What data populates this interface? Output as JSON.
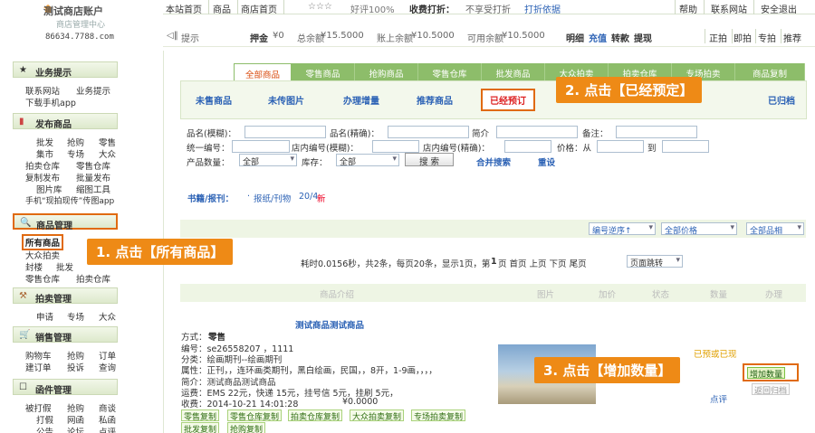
{
  "logo": {
    "title": "测试商店账户",
    "subtitle": "商店管理中心",
    "phone": "86634.7788.com"
  },
  "topnav": {
    "items": [
      "本站首页",
      "商品",
      "商店首页"
    ],
    "stars": "☆☆☆",
    "rating": "好评100%",
    "discount_label": "收费打折：",
    "discount_value": "不享受打折",
    "discount_link": "打折依据",
    "right": [
      "帮助",
      "联系网站",
      "安全退出"
    ]
  },
  "bar2": {
    "hint": "提示",
    "deposit_label": "押金",
    "deposit_value": "¥0",
    "total_label": "总余额",
    "total_value": "¥15.5000",
    "account_label": "账上余额",
    "account_value": "¥10.5000",
    "avail_label": "可用余额",
    "avail_value": "¥10.5000",
    "links": [
      "明细",
      "充值",
      "转款",
      "提现"
    ],
    "right": [
      "正拍",
      "即拍",
      "专拍",
      "推荐"
    ]
  },
  "sidebar": {
    "sections": [
      "业务提示",
      "发布商品",
      "商品管理",
      "拍卖管理",
      "销售管理",
      "函件管理"
    ],
    "s1": [
      "联系网站",
      "业务提示",
      "下载手机app"
    ],
    "s2": [
      "批发",
      "抢购",
      "零售",
      "集市",
      "专场",
      "大众",
      "拍卖仓库",
      "零售仓库",
      "复制发布",
      "批量发布",
      "图片库",
      "缩图工具",
      "手机“现拍现传”传图app"
    ],
    "s3_all": "所有商品",
    "s3": [
      "大众拍卖",
      "封楼",
      "批发",
      "零售仓库",
      "拍卖仓库"
    ],
    "s4": [
      "申请",
      "专场",
      "大众"
    ],
    "s5": [
      "购物车",
      "抢购",
      "订单",
      "建订单",
      "投诉",
      "查询"
    ],
    "s6": [
      "被打假",
      "抢购",
      "商谈",
      "打假",
      "网函",
      "私函",
      "公告",
      "论坛",
      "点评"
    ]
  },
  "tabs": [
    "全部商品",
    "零售商品",
    "抢购商品",
    "零售仓库",
    "批发商品",
    "大众拍卖",
    "拍卖仓库",
    "专场拍卖",
    "商品复制"
  ],
  "subtabs": [
    "未售商品",
    "未传图片",
    "办理增量",
    "推荐商品",
    "已经预订",
    "已归档"
  ],
  "form": {
    "name_fuzzy": "品名(模糊)：",
    "name_exact": "品名(精确)：",
    "intro": "简介",
    "note": "备注：",
    "code": "统一编号：",
    "store_fuzzy": "店内编号(模糊)：",
    "store_exact": "店内编号(精确)：",
    "price": "价格：从",
    "to": "到",
    "qty": "产品数量：",
    "qty_val": "全部",
    "stock": "库存：",
    "stock_val": "全部",
    "search": "搜 索",
    "combined": "合并搜索",
    "reset": "重设"
  },
  "category": {
    "label": "书籍/报刊：",
    "path": "报纸/刊物",
    "count": "20/4",
    "new": "新"
  },
  "filters": [
    "编号逆序↑",
    "全部价格",
    "全部品相"
  ],
  "stats": {
    "text": "耗时0.0156秒，共2条，每页20条，显示1页，第",
    "page": "1",
    "text2": "页 首页 上页 下页 尾页",
    "jump": "页面跳转"
  },
  "table_head": [
    "商品介绍",
    "图片",
    "加价",
    "状态",
    "数量",
    "办理"
  ],
  "product": {
    "title": "测试商品测试商品",
    "method_label": "方式：",
    "method": "零售",
    "code": "编号：se26558207 ，1111",
    "category": "分类：绘画期刊--绘画期刊",
    "attr": "属性：正刊，，连环画类期刊，黑白绘画，民国，，8开，1-9画，，，，",
    "intro": "简介：测试商品测试商品",
    "ship": "运费：EMS 22元，快递 15元，挂号信 5元，挂刷 5元，",
    "time": "收费：2014-10-21 14:01:28",
    "fee": "¥0.0000",
    "copies": [
      "零售复制",
      "零售仓库复制",
      "拍卖仓库复制",
      "大众拍卖复制",
      "专场拍卖复制",
      "批发复制",
      "抢购复制"
    ],
    "status": "已预或已现",
    "review": "点评",
    "add_qty": "增加数量",
    "back": "返回归档"
  },
  "callouts": {
    "c1": "1. 点击【所有商品】",
    "c2": "2. 点击【已经预定】",
    "c3": "3. 点击【增加数量】"
  }
}
